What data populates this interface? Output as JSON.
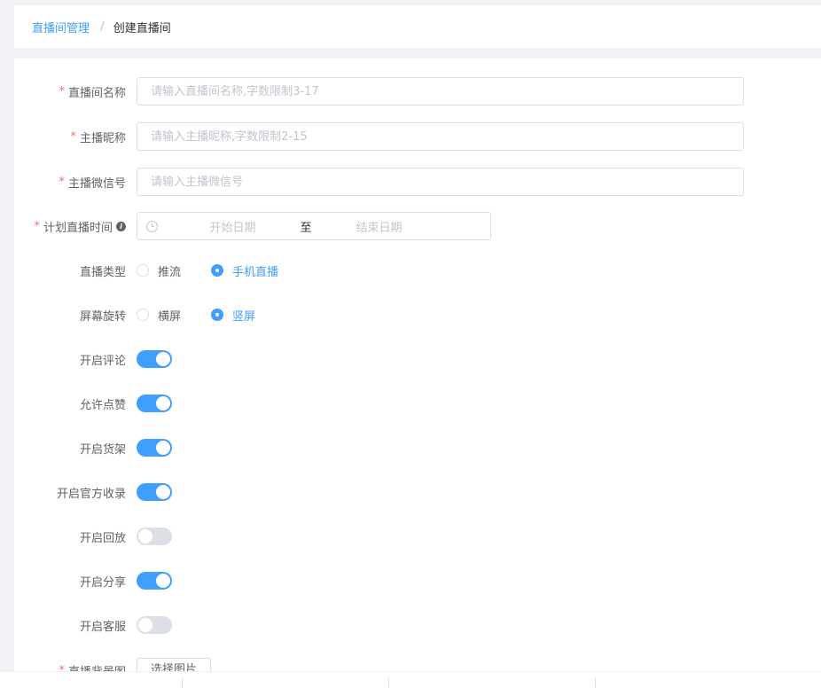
{
  "breadcrumb": {
    "parent": "直播间管理",
    "separator": "/",
    "current": "创建直播间"
  },
  "form": {
    "room_name": {
      "label": "直播间名称",
      "required": true,
      "value": "",
      "placeholder": "请输入直播间名称,字数限制3-17"
    },
    "anchor_nickname": {
      "label": "主播昵称",
      "required": true,
      "value": "",
      "placeholder": "请输入主播昵称,字数限制2-15"
    },
    "anchor_wechat": {
      "label": "主播微信号",
      "required": true,
      "value": "",
      "placeholder": "请输入主播微信号"
    },
    "plan_time": {
      "label": "计划直播时间",
      "required": true,
      "start_placeholder": "开始日期",
      "range_separator": "至",
      "end_placeholder": "结束日期",
      "icon": "clock-icon",
      "info_icon": "info-icon"
    },
    "live_type": {
      "label": "直播类型",
      "options": [
        "推流",
        "手机直播"
      ],
      "selected": "手机直播"
    },
    "screen_rotate": {
      "label": "屏幕旋转",
      "options": [
        "横屏",
        "竖屏"
      ],
      "selected": "竖屏"
    },
    "switches": [
      {
        "label": "开启评论",
        "on": true
      },
      {
        "label": "允许点赞",
        "on": true
      },
      {
        "label": "开启货架",
        "on": true
      },
      {
        "label": "开启官方收录",
        "on": true
      },
      {
        "label": "开启回放",
        "on": false
      },
      {
        "label": "开启分享",
        "on": true
      },
      {
        "label": "开启客服",
        "on": false
      }
    ],
    "background": {
      "label": "直播背景图",
      "required": true,
      "button": "选择图片"
    }
  },
  "colors": {
    "primary": "#409eff",
    "required": "#f56c6c",
    "switch_off": "#dcdfe6",
    "border": "#dcdfe6",
    "placeholder": "#c0c4cc"
  }
}
